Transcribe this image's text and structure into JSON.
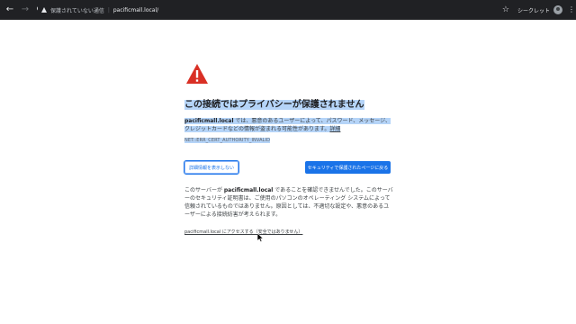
{
  "browser": {
    "security_status": "保護されていない通信",
    "url": "pacificmall.local/",
    "incognito_label": "シークレット",
    "back_glyph": "←",
    "forward_glyph": "→",
    "reload_glyph": "⟳",
    "star_glyph": "☆",
    "menu_glyph": "⋮"
  },
  "interstitial": {
    "heading": "この接続ではプライバシーが保護されません",
    "desc_domain": "pacificmall.local",
    "desc_text": " では、悪意のあるユーザーによって、パスワード、メッセージ、クレジットカードなどの情報が盗まれる可能性があります。",
    "desc_link": "詳細",
    "error_code": "NET::ERR_CERT_AUTHORITY_INVALID",
    "details_button": "詳細情報を表示しない",
    "back_button": "セキュリティで保護されたページに戻る",
    "explain_pre": "このサーバーが ",
    "explain_domain": "pacificmall.local",
    "explain_post": " であることを確認できませんでした。このサーバーのセキュリティ証明書は、ご使用のパソコンのオペレーティング システムによって信頼されているものではありません。原因としては、不適切な設定や、悪意のあるユーザーによる接続妨害が考えられます。",
    "proceed_link": "pacificmall.local にアクセスする（安全ではありません）"
  },
  "colors": {
    "toolbar_bg": "#202124",
    "warning_red": "#d93025",
    "primary_blue": "#1a73e8",
    "selection_highlight": "#b5d4f8"
  }
}
